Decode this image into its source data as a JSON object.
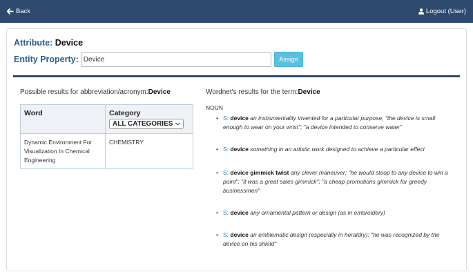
{
  "nav": {
    "back_label": "Back",
    "logout_label": "Logout (User)"
  },
  "attribute": {
    "label": "Attribute:",
    "value": "Device"
  },
  "entity": {
    "label": "Entity Property:",
    "input_value": "Device",
    "assign_label": "Assign"
  },
  "abbreviation": {
    "heading_prefix": "Possible results for abbreviation/acronym:",
    "heading_term": "Device",
    "columns": {
      "word": "Word",
      "category": "Category"
    },
    "category_select": "ALL CATEGORIES",
    "rows": [
      {
        "word": "Dynamic Environment For Visualization In Chemical Engineering",
        "category": "CHEMISTRY"
      }
    ]
  },
  "wordnet": {
    "heading_prefix": "Wordnet's results for the term:",
    "heading_term": "Device",
    "pos": "NOUN",
    "senses": [
      {
        "link": "S:",
        "term": "device",
        "gloss": "an instrumentality invented for a particular purpose; \"the device is small enough to wear on your wrist\"; \"a device intended to conserve water\""
      },
      {
        "link": "S:",
        "term": "device",
        "gloss": "something in an artistic work designed to achieve a particular effect"
      },
      {
        "link": "S:",
        "term": "device gimmick twist",
        "gloss": "any clever maneuver; \"he would stoop to any device to win a point\"; \"it was a great sales gimmick\"; \"a cheap promotions gimmick for greedy businessmen\""
      },
      {
        "link": "S:",
        "term": "device",
        "gloss": "any ornamental pattern or design (as in embroidery)"
      },
      {
        "link": "S:",
        "term": "device",
        "gloss": "an emblematic design (especially in heraldry); \"he was recognized by the device on his shield\""
      }
    ]
  }
}
